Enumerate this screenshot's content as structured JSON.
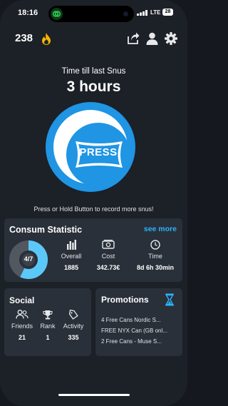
{
  "status_bar": {
    "time": "18:16",
    "network": "LTE",
    "battery": "28"
  },
  "header": {
    "streak_count": "238",
    "icons": [
      "share-icon",
      "profile-icon",
      "settings-icon"
    ]
  },
  "timer": {
    "title": "Time till last Snus",
    "value": "3 hours"
  },
  "press_button": {
    "label": "PRESS",
    "hint": "Press or Hold Button to record more snus!"
  },
  "consum_statistic": {
    "title": "Consum Statistic",
    "see_more": "see more",
    "progress_label": "4/7",
    "progress_fraction": 0.571,
    "overall": {
      "label": "Overall",
      "value": "1885"
    },
    "cost": {
      "label": "Cost",
      "value": "342.73€"
    },
    "time": {
      "label": "Time",
      "value": "8d 6h 30min"
    }
  },
  "social": {
    "title": "Social",
    "friends": {
      "label": "Friends",
      "value": "21"
    },
    "rank": {
      "label": "Rank",
      "value": "1"
    },
    "activity": {
      "label": "Activity",
      "value": "335"
    }
  },
  "promotions": {
    "title": "Promotions",
    "items": [
      "4 Free Cans Nordic S...",
      "FREE NYX Can (GB onl...",
      "2 Free Cans - Muse S..."
    ]
  },
  "colors": {
    "accent": "#1f95e3",
    "link": "#29b4ff",
    "flame": "#f5b400",
    "background": "#1c2027",
    "card": "#2a3039"
  }
}
